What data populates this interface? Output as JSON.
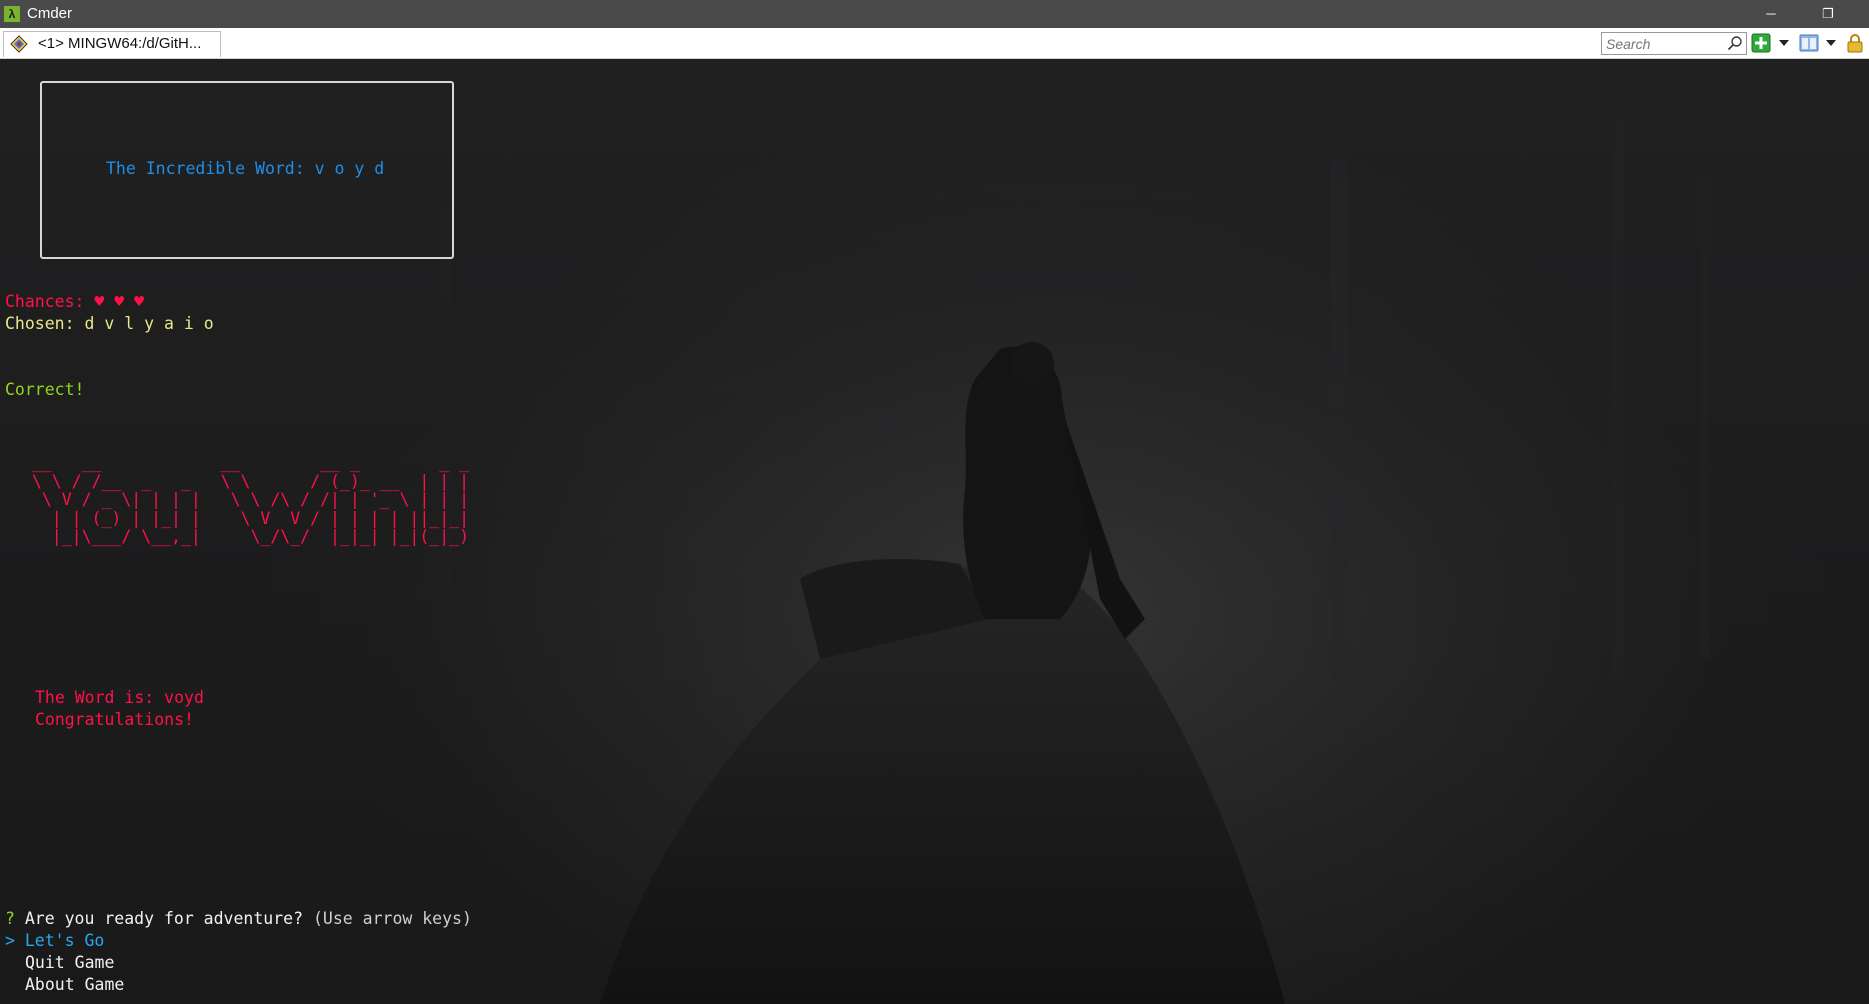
{
  "window": {
    "title": "Cmder",
    "app_icon": "lambda-icon",
    "controls": {
      "minimize": "─",
      "restore": "❐"
    }
  },
  "tabs": [
    {
      "label": "<1> MINGW64:/d/GitH...",
      "icon": "console-tab-icon"
    }
  ],
  "toolbar": {
    "search_placeholder": "Search",
    "icons": [
      "search-icon",
      "new-console-icon",
      "dropdown-icon",
      "layout-icon",
      "dropdown-icon",
      "lock-icon"
    ]
  },
  "game": {
    "word_box": {
      "label": "The Incredible Word:",
      "letters": "v o y d"
    },
    "chances_label": "Chances:",
    "chances_hearts": "♥ ♥ ♥",
    "chosen_label": "Chosen:",
    "chosen_letters": "d v l y a i o",
    "feedback": "Correct!",
    "ascii_banner": " __   __            __        __ _        _ _\n \\ \\ / /__  _   _   \\ \\      / (_)_ __  | | |\n  \\ V / _ \\| | | |   \\ \\ /\\ / /| | '_ \\ | | |\n   | | (_) | |_| |    \\ V  V / | | | | ||_|_|\n   |_|\\___/ \\__,_|     \\_/\\_/  |_|_| |_|(_|_)",
    "result_word_line": "The Word is: voyd",
    "congrats": "Congratulations!"
  },
  "prompt": {
    "marker": "?",
    "question": "Are you ready for adventure?",
    "hint": "(Use arrow keys)",
    "pointer": ">",
    "options": [
      "Let's Go",
      "Quit Game",
      "About Game"
    ],
    "selected_index": 0
  },
  "colors": {
    "titlebar": "#4a4a4a",
    "terminal_bg": "#1b1b1c",
    "word_blue": "#1e8fe8",
    "red": "#ff1148",
    "yellow": "#e8e88a",
    "green": "#8fd61f",
    "cyan": "#27a9f0"
  }
}
